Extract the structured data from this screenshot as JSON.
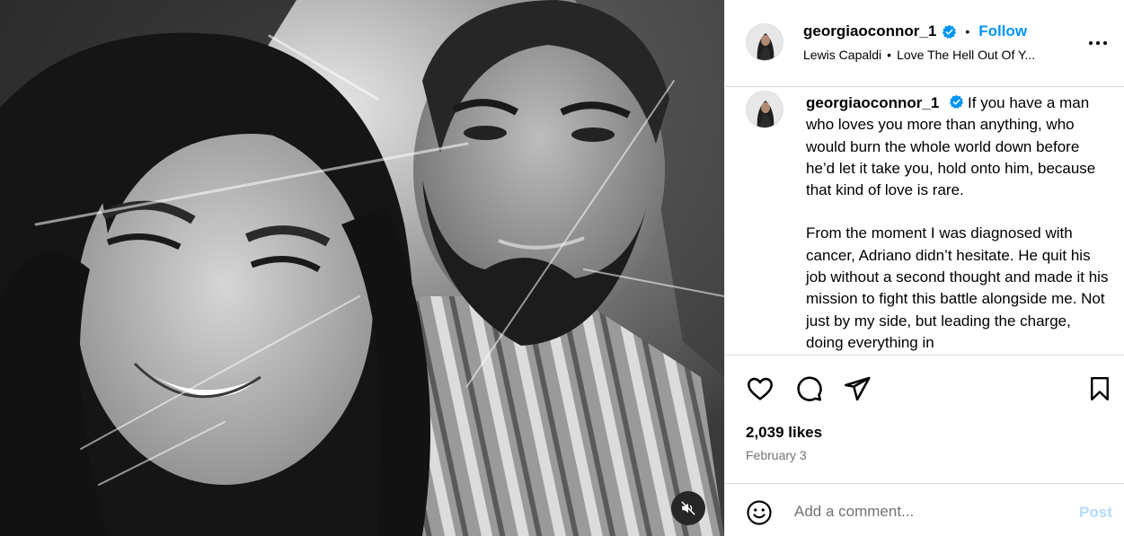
{
  "post": {
    "username": "georgiaoconnor_1",
    "follow_label": "Follow",
    "separator": "•",
    "audio": {
      "artist": "Lewis Capaldi",
      "track": "Love The Hell Out Of Y..."
    },
    "caption": {
      "username": "georgiaoconnor_1",
      "paragraph1": "If you have a man who loves you more than anything, who would burn the whole world down before he’d let it take you, hold onto him, because that kind of love is rare.",
      "paragraph2": "From the moment I was diagnosed with cancer, Adriano didn’t hesitate. He quit his job without a second thought and made it his mission to fight this battle alongside me. Not just by my side, but leading the charge, doing everything in"
    },
    "likes": "2,039 likes",
    "date": "February 3"
  },
  "comment": {
    "placeholder": "Add a comment...",
    "post_label": "Post"
  },
  "icons": {
    "verified": "verified-badge-icon",
    "more": "more-options-icon",
    "like": "heart-icon",
    "comment": "comment-bubble-icon",
    "share": "paper-plane-icon",
    "save": "bookmark-icon",
    "emoji": "smiley-icon",
    "mute": "speaker-muted-icon"
  },
  "colors": {
    "accent": "#0095f6",
    "post_disabled": "#b3dbff",
    "secondary_text": "#737373",
    "verified": "#0095f6"
  }
}
